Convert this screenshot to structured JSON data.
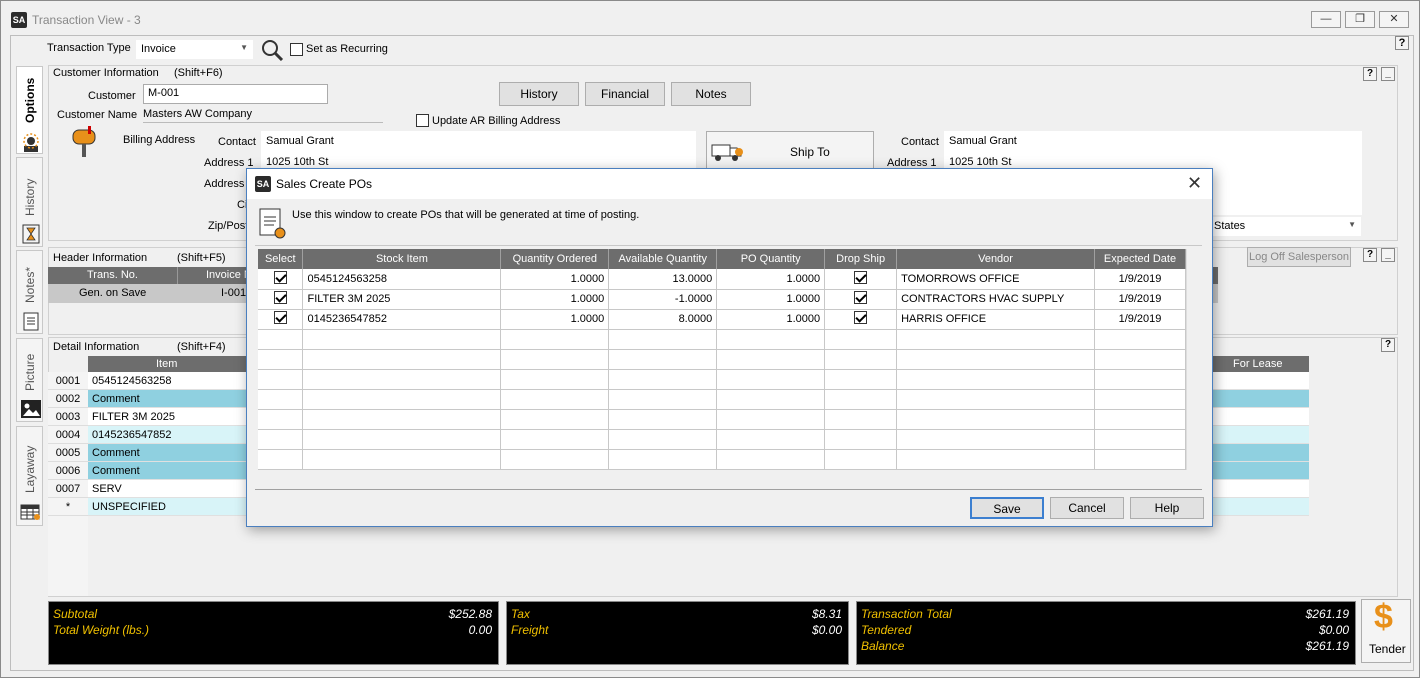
{
  "window": {
    "logo": "SA",
    "title": "Transaction View - 3",
    "help": "?"
  },
  "toolbar": {
    "transaction_type_label": "Transaction Type",
    "transaction_type_value": "Invoice",
    "set_recurring_label": "Set as Recurring"
  },
  "sidebar": {
    "tabs": [
      "Options",
      "History",
      "Notes*",
      "Picture",
      "Layaway"
    ]
  },
  "customer": {
    "section_title": "Customer Information",
    "shortcut": "(Shift+F6)",
    "customer_label": "Customer",
    "customer_value": "M-001",
    "name_label": "Customer Name",
    "name_value": "Masters AW Company",
    "history_btn": "History",
    "financial_btn": "Financial",
    "notes_btn": "Notes",
    "update_ar_label": "Update AR Billing Address",
    "billing_label": "Billing Address",
    "contact_label": "Contact",
    "contact_value": "Samual Grant",
    "address1_label": "Address 1",
    "address1_value": "1025 10th St",
    "address_label_partial": "Address",
    "city_label_partial": "Ci",
    "zip_label_partial": "Zip/Post",
    "ship_to_btn": "Ship To",
    "ship_contact_label": "Contact",
    "ship_contact_value": "Samual Grant",
    "ship_address1_label": "Address 1",
    "ship_address1_value": "1025 10th St",
    "country_partial": "States"
  },
  "header_info": {
    "section_title": "Header Information",
    "shortcut": "(Shift+F5)",
    "col_trans_no": "Trans. No.",
    "col_invoice_partial": "Invoice N",
    "trans_no_value": "Gen. on Save",
    "invoice_partial_value": "I-001(",
    "log_off_btn": "Log Off Salesperson"
  },
  "detail": {
    "section_title": "Detail Information",
    "shortcut": "(Shift+F4)",
    "col_item": "Item",
    "col_for_lease": "For Lease",
    "rows": [
      {
        "num": "0001",
        "item": "0545124563258",
        "style": "white"
      },
      {
        "num": "0002",
        "item": "Comment",
        "style": "blue"
      },
      {
        "num": "0003",
        "item": "FILTER 3M 2025",
        "style": "white"
      },
      {
        "num": "0004",
        "item": "0145236547852",
        "style": "light"
      },
      {
        "num": "0005",
        "item": "Comment",
        "style": "blue"
      },
      {
        "num": "0006",
        "item": "Comment",
        "style": "blue"
      },
      {
        "num": "0007",
        "item": "SERV",
        "style": "white"
      },
      {
        "num": "*",
        "item": "UNSPECIFIED",
        "style": "light"
      }
    ]
  },
  "totals": {
    "subtotal_label": "Subtotal",
    "subtotal_value": "$252.88",
    "weight_label": "Total Weight (lbs.)",
    "weight_value": "0.00",
    "tax_label": "Tax",
    "tax_value": "$8.31",
    "freight_label": "Freight",
    "freight_value": "$0.00",
    "trans_total_label": "Transaction Total",
    "trans_total_value": "$261.19",
    "tendered_label": "Tendered",
    "tendered_value": "$0.00",
    "balance_label": "Balance",
    "balance_value": "$261.19",
    "tender_btn": "Tender"
  },
  "modal": {
    "logo": "SA",
    "title": "Sales Create POs",
    "description": "Use this window to create POs that will be generated at time of posting.",
    "columns": [
      "Select",
      "Stock Item",
      "Quantity Ordered",
      "Available Quantity",
      "PO Quantity",
      "Drop Ship",
      "Vendor",
      "Expected Date"
    ],
    "rows": [
      {
        "select": true,
        "stock_item": "0545124563258",
        "qty_ordered": "1.0000",
        "avail_qty": "13.0000",
        "po_qty": "1.0000",
        "drop_ship": true,
        "vendor": "TOMORROWS OFFICE",
        "expected": "1/9/2019"
      },
      {
        "select": true,
        "stock_item": "FILTER 3M 2025",
        "qty_ordered": "1.0000",
        "avail_qty": "-1.0000",
        "po_qty": "1.0000",
        "drop_ship": true,
        "vendor": "CONTRACTORS HVAC SUPPLY",
        "expected": "1/9/2019"
      },
      {
        "select": true,
        "stock_item": "0145236547852",
        "qty_ordered": "1.0000",
        "avail_qty": "8.0000",
        "po_qty": "1.0000",
        "drop_ship": true,
        "vendor": "HARRIS OFFICE",
        "expected": "1/9/2019"
      }
    ],
    "empty_rows": 7,
    "save_btn": "Save",
    "cancel_btn": "Cancel",
    "help_btn": "Help"
  },
  "colors": {
    "row_blue": "#8fd0e0",
    "row_light": "#d8f4f8",
    "totals_bg": "#000000",
    "totals_label": "#f0c000",
    "accent_border": "#4a7fbf",
    "tender_icon": "#e8901a"
  }
}
